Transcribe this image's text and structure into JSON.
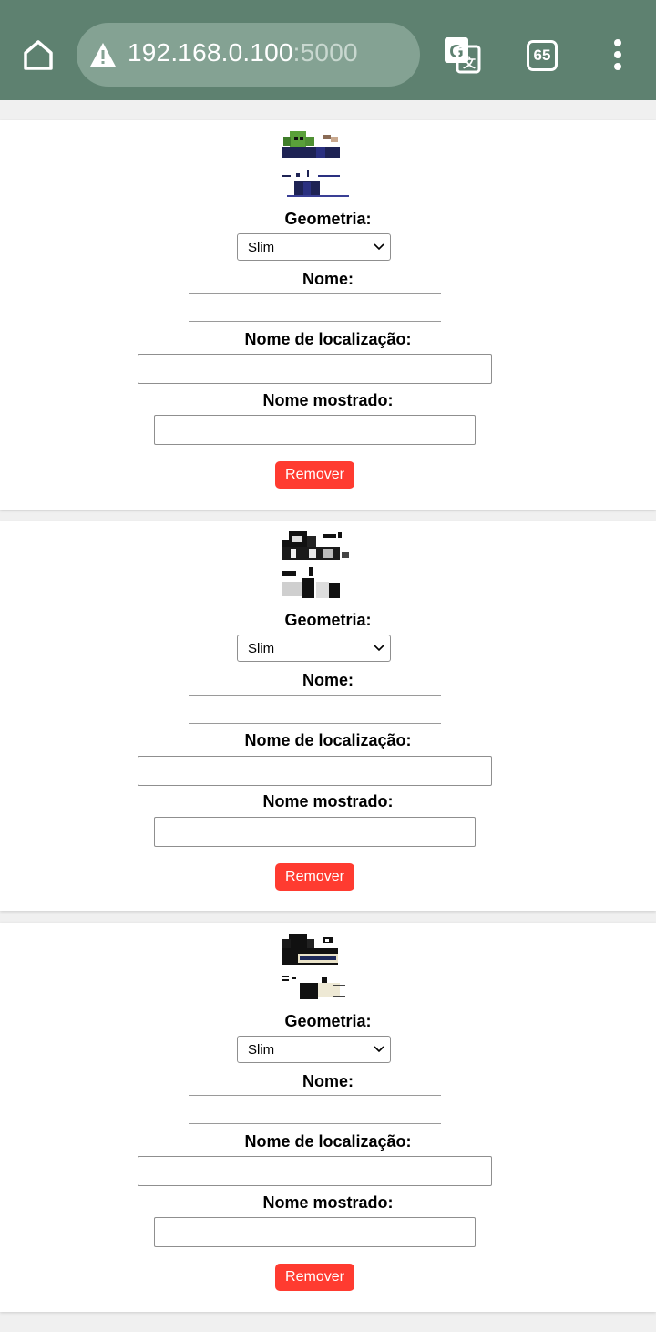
{
  "browser": {
    "home_icon": "home-icon",
    "security_icon": "warning-triangle-icon",
    "url_host": "192.168.0.100",
    "url_port": ":5000",
    "translate_icon": "google-translate-icon",
    "tab_count": "65",
    "menu_icon": "more-vert-icon"
  },
  "skins": [
    {
      "geometry_label": "Geometria:",
      "geometry_value": "Slim",
      "name_label": "Nome:",
      "name_value": "",
      "location_label": "Nome de localização:",
      "location_value": "",
      "display_label": "Nome mostrado:",
      "display_value": "",
      "remove_label": "Remover"
    },
    {
      "geometry_label": "Geometria:",
      "geometry_value": "Slim",
      "name_label": "Nome:",
      "name_value": "",
      "location_label": "Nome de localização:",
      "location_value": "",
      "display_label": "Nome mostrado:",
      "display_value": "",
      "remove_label": "Remover"
    },
    {
      "geometry_label": "Geometria:",
      "geometry_value": "Slim",
      "name_label": "Nome:",
      "name_value": "",
      "location_label": "Nome de localização:",
      "location_value": "",
      "display_label": "Nome mostrado:",
      "display_value": "",
      "remove_label": "Remover"
    }
  ],
  "colors": {
    "toolbar": "#5e8170",
    "remove_button": "#ff3b30"
  }
}
